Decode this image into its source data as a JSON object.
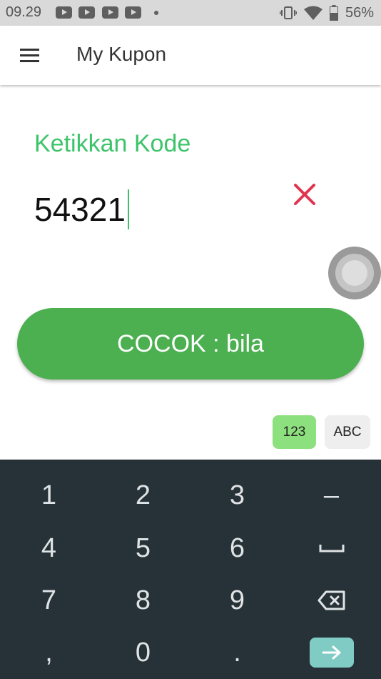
{
  "status_bar": {
    "time": "09.29",
    "notification_icons": [
      "youtube-icon",
      "youtube-icon",
      "youtube-icon",
      "youtube-icon",
      "more-dot-icon"
    ],
    "battery_percent": "56%",
    "right_icons": [
      "vibrate-icon",
      "wifi-icon",
      "battery-icon"
    ]
  },
  "app_bar": {
    "title": "My Kupon",
    "menu_icon": "hamburger-menu-icon"
  },
  "form": {
    "label": "Ketikkan Kode",
    "code_value": "54321",
    "clear_icon": "close-icon"
  },
  "match_button": {
    "label": "COCOK : bila"
  },
  "keyboard_mode": {
    "numeric_label": "123",
    "alpha_label": "ABC",
    "active": "123"
  },
  "keyboard": {
    "rows": [
      [
        "1",
        "2",
        "3",
        "–"
      ],
      [
        "4",
        "5",
        "6",
        "space"
      ],
      [
        "7",
        "8",
        "9",
        "backspace"
      ],
      [
        ",",
        "0",
        ".",
        "enter"
      ]
    ]
  },
  "colors": {
    "accent_green": "#3dc46a",
    "button_green": "#4caf50",
    "clear_red": "#e0344f",
    "keyboard_bg": "#263238",
    "enter_key": "#80cbc4",
    "mode_active": "#8de07e"
  }
}
